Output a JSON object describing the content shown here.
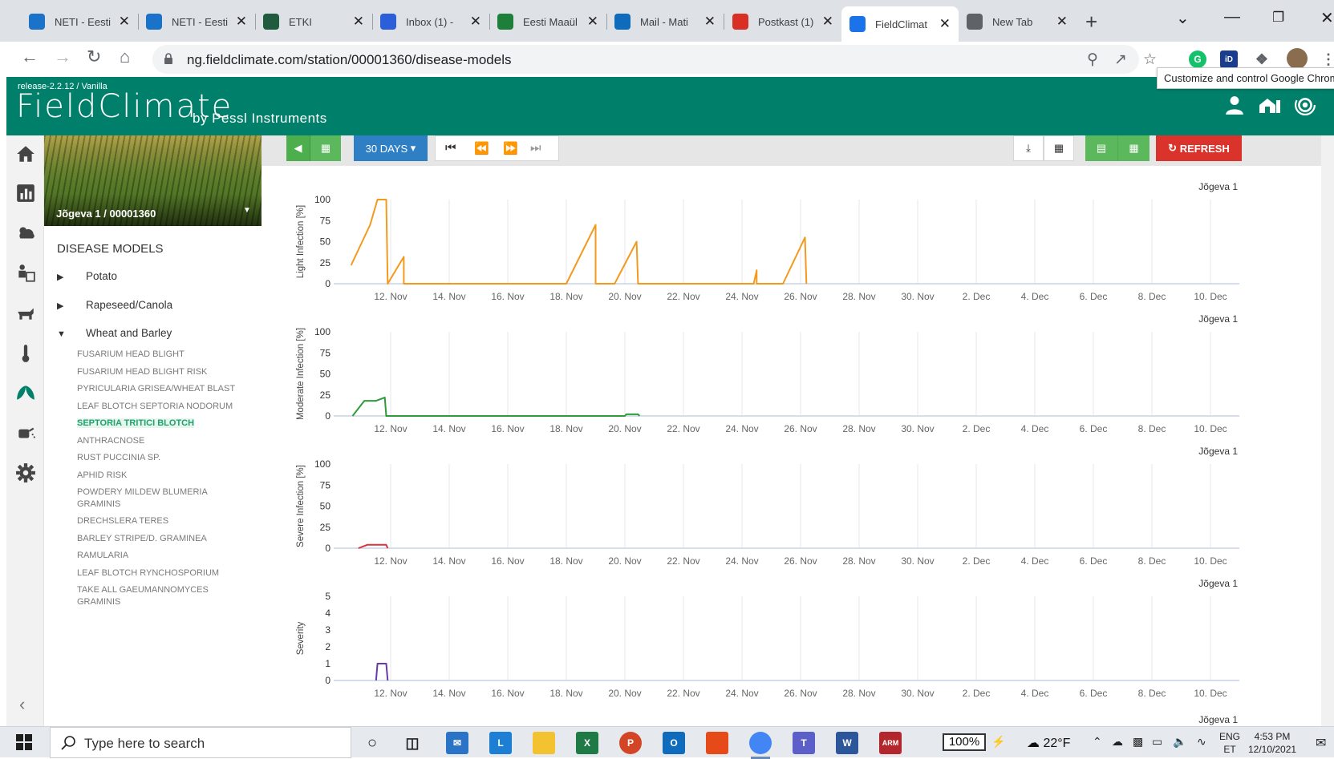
{
  "browser": {
    "tabs": [
      {
        "label": "NETI - Eesti",
        "icon_color": "#1a73c8",
        "icon": "neti-icon"
      },
      {
        "label": "NETI - Eesti",
        "icon_color": "#1a73c8",
        "icon": "neti-icon"
      },
      {
        "label": "ETKI",
        "icon_color": "#1f5b3c",
        "icon": "etki-icon"
      },
      {
        "label": "Inbox (1) - ",
        "icon_color": "#2b5fd9",
        "icon": "inbox-icon"
      },
      {
        "label": "Eesti Maaül",
        "icon_color": "#1e7f3a",
        "icon": "emu-icon"
      },
      {
        "label": "Mail - Mati",
        "icon_color": "#0f6cbd",
        "icon": "outlook-icon"
      },
      {
        "label": "Postkast (1)",
        "icon_color": "#d93025",
        "icon": "gmail-icon"
      },
      {
        "label": "FieldClimat",
        "icon_color": "#1a73e8",
        "icon": "fieldclimate-icon"
      },
      {
        "label": "New Tab",
        "icon_color": "#5f6368",
        "icon": "chrome-icon"
      }
    ],
    "active_tab_index": 7,
    "url_host": "ng.fieldclimate.com",
    "url_path": "/station/00001360/disease-models",
    "tooltip": "Customize and control Google Chrome"
  },
  "header": {
    "release": "release-2.2.12 / Vanilla",
    "logo": "FieldClimate",
    "logo_sub": "by Pessl Instruments",
    "brand_color": "#00806a"
  },
  "sidebar": {
    "station": "Jõgeva 1 / 00001360",
    "section_title": "DISEASE MODELS",
    "groups": [
      {
        "label": "Potato",
        "expanded": false
      },
      {
        "label": "Rapeseed/Canola",
        "expanded": false
      },
      {
        "label": "Wheat and Barley",
        "expanded": true
      }
    ],
    "models": [
      "FUSARIUM HEAD BLIGHT",
      "FUSARIUM HEAD BLIGHT RISK",
      "PYRICULARIA GRISEA/WHEAT BLAST",
      "LEAF BLOTCH SEPTORIA NODORUM",
      "SEPTORIA TRITICI BLOTCH",
      "ANTHRACNOSE",
      "RUST PUCCINIA SP.",
      "APHID RISK",
      "POWDERY MILDEW BLUMERIA GRAMINIS",
      "DRECHSLERA TERES",
      "BARLEY STRIPE/D. GRAMINEA",
      "RAMULARIA",
      "LEAF BLOTCH RYNCHOSPORIUM",
      "TAKE ALL GAEUMANNOMYCES GRAMINIS"
    ],
    "selected_model_index": 4
  },
  "controls": {
    "period": "30 DAYS",
    "refresh": "REFRESH"
  },
  "chart_data": [
    {
      "type": "line",
      "station_label": "Jõgeva 1",
      "ylabel": "Light Infection [%]",
      "ylim": [
        0,
        100
      ],
      "yticks": [
        0,
        25,
        50,
        75,
        100
      ],
      "color": "#f39a1e",
      "x_ticks": [
        "12. Nov",
        "14. Nov",
        "16. Nov",
        "18. Nov",
        "20. Nov",
        "22. Nov",
        "24. Nov",
        "26. Nov",
        "28. Nov",
        "30. Nov",
        "2. Dec",
        "4. Dec",
        "6. Dec",
        "8. Dec",
        "10. Dec"
      ],
      "x_unit": "days since 12. Nov",
      "points": [
        [
          -1.35,
          22
        ],
        [
          -0.7,
          70
        ],
        [
          -0.45,
          100
        ],
        [
          -0.15,
          100
        ],
        [
          -0.1,
          0
        ],
        [
          0.45,
          32
        ],
        [
          0.45,
          0
        ],
        [
          6.0,
          0
        ],
        [
          7.0,
          70
        ],
        [
          7.0,
          0
        ],
        [
          7.65,
          0
        ],
        [
          8.4,
          50
        ],
        [
          8.45,
          0
        ],
        [
          12.4,
          0
        ],
        [
          12.5,
          16
        ],
        [
          12.5,
          0
        ],
        [
          13.4,
          0
        ],
        [
          14.15,
          55
        ],
        [
          14.2,
          0
        ]
      ]
    },
    {
      "type": "line",
      "station_label": "Jõgeva 1",
      "ylabel": "Moderate Infection [%]",
      "ylim": [
        0,
        100
      ],
      "yticks": [
        0,
        25,
        50,
        75,
        100
      ],
      "color": "#2e9c3a",
      "x_ticks": [
        "12. Nov",
        "14. Nov",
        "16. Nov",
        "18. Nov",
        "20. Nov",
        "22. Nov",
        "24. Nov",
        "26. Nov",
        "28. Nov",
        "30. Nov",
        "2. Dec",
        "4. Dec",
        "6. Dec",
        "8. Dec",
        "10. Dec"
      ],
      "x_unit": "days since 12. Nov",
      "points": [
        [
          -1.3,
          0
        ],
        [
          -0.9,
          18
        ],
        [
          -0.5,
          18
        ],
        [
          -0.2,
          22
        ],
        [
          -0.15,
          0
        ],
        [
          0.45,
          0
        ],
        [
          8.0,
          0
        ],
        [
          8.05,
          2
        ],
        [
          8.45,
          2
        ],
        [
          8.5,
          0
        ]
      ]
    },
    {
      "type": "line",
      "station_label": "Jõgeva 1",
      "ylabel": "Severe Infection [%]",
      "ylim": [
        0,
        100
      ],
      "yticks": [
        0,
        25,
        50,
        75,
        100
      ],
      "color": "#d9333f",
      "x_ticks": [
        "12. Nov",
        "14. Nov",
        "16. Nov",
        "18. Nov",
        "20. Nov",
        "22. Nov",
        "24. Nov",
        "26. Nov",
        "28. Nov",
        "30. Nov",
        "2. Dec",
        "4. Dec",
        "6. Dec",
        "8. Dec",
        "10. Dec"
      ],
      "x_unit": "days since 12. Nov",
      "points": [
        [
          -1.1,
          0
        ],
        [
          -0.8,
          4
        ],
        [
          -0.15,
          4
        ],
        [
          -0.1,
          0
        ]
      ]
    },
    {
      "type": "line",
      "station_label": "Jõgeva 1",
      "ylabel": "Severity",
      "ylim": [
        0,
        5
      ],
      "yticks": [
        0,
        1,
        2,
        3,
        4,
        5
      ],
      "color": "#6a3aa8",
      "x_ticks": [
        "12. Nov",
        "14. Nov",
        "16. Nov",
        "18. Nov",
        "20. Nov",
        "22. Nov",
        "24. Nov",
        "26. Nov",
        "28. Nov",
        "30. Nov",
        "2. Dec",
        "4. Dec",
        "6. Dec",
        "8. Dec",
        "10. Dec"
      ],
      "x_unit": "days since 12. Nov",
      "points": [
        [
          -0.5,
          0
        ],
        [
          -0.45,
          1
        ],
        [
          -0.15,
          1
        ],
        [
          -0.1,
          0
        ]
      ]
    }
  ],
  "extra_station_label": "Jõgeva 1",
  "taskbar": {
    "search_placeholder": "Type here to search",
    "zoom": "100%",
    "weather": "22°F",
    "lang_top": "ENG",
    "lang_bottom": "ET",
    "time": "4:53 PM",
    "date": "12/10/2021"
  }
}
